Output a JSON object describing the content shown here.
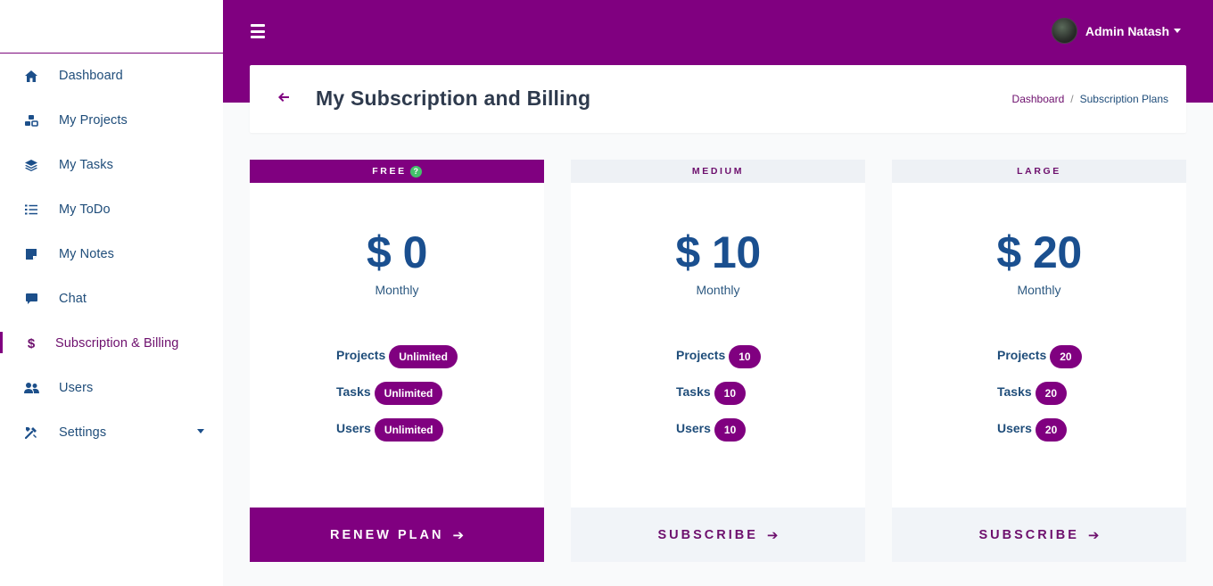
{
  "sidebar": {
    "items": [
      {
        "label": "Dashboard",
        "icon": "home-icon"
      },
      {
        "label": "My Projects",
        "icon": "projects-icon"
      },
      {
        "label": "My Tasks",
        "icon": "layers-icon"
      },
      {
        "label": "My ToDo",
        "icon": "list-check-icon"
      },
      {
        "label": "My Notes",
        "icon": "note-icon"
      },
      {
        "label": "Chat",
        "icon": "chat-icon"
      },
      {
        "label": "Subscription & Billing",
        "icon": "dollar-icon",
        "active": true
      },
      {
        "label": "Users",
        "icon": "users-icon"
      },
      {
        "label": "Settings",
        "icon": "settings-icon"
      }
    ]
  },
  "topbar": {
    "user_name": "Admin Natash"
  },
  "header": {
    "title": "My Subscription and Billing",
    "breadcrumb": [
      "Dashboard",
      "Subscription Plans"
    ],
    "breadcrumb_separator": "/"
  },
  "plans": [
    {
      "name": "FREE",
      "price": "$ 0",
      "period": "Monthly",
      "features": [
        {
          "label": "Projects",
          "value": "Unlimited"
        },
        {
          "label": "Tasks",
          "value": "Unlimited"
        },
        {
          "label": "Users",
          "value": "Unlimited"
        }
      ],
      "action": "RENEW PLAN",
      "current": true
    },
    {
      "name": "MEDIUM",
      "price": "$ 10",
      "period": "Monthly",
      "features": [
        {
          "label": "Projects",
          "value": "10"
        },
        {
          "label": "Tasks",
          "value": "10"
        },
        {
          "label": "Users",
          "value": "10"
        }
      ],
      "action": "SUBSCRIBE"
    },
    {
      "name": "LARGE",
      "price": "$ 20",
      "period": "Monthly",
      "features": [
        {
          "label": "Projects",
          "value": "20"
        },
        {
          "label": "Tasks",
          "value": "20"
        },
        {
          "label": "Users",
          "value": "20"
        }
      ],
      "action": "SUBSCRIBE"
    }
  ],
  "colors": {
    "brand": "#800080",
    "text_primary": "#1a4f8f",
    "help_badge": "#44c26b"
  }
}
